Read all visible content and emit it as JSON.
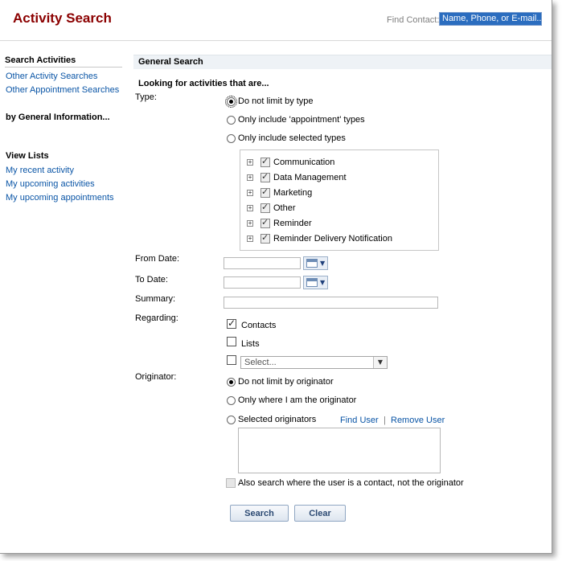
{
  "header": {
    "title": "Activity Search",
    "find_contact_label": "Find Contact:",
    "find_contact_value": "Name, Phone, or E-mail..."
  },
  "sidebar": {
    "search_activities_heading": "Search Activities",
    "search_links": [
      "Other Activity Searches",
      "Other Appointment Searches"
    ],
    "general_info_heading": "by General Information...",
    "view_lists_heading": "View Lists",
    "view_links": [
      "My recent activity",
      "My upcoming activities",
      "My upcoming appointments"
    ]
  },
  "main": {
    "section_title": "General Search",
    "looking_for": "Looking for activities that are...",
    "type_label": "Type:",
    "type_options": [
      {
        "label": "Do not limit by type",
        "selected": true
      },
      {
        "label": "Only include 'appointment' types",
        "selected": false
      },
      {
        "label": "Only include selected types",
        "selected": false
      }
    ],
    "type_tree": [
      {
        "label": "Communication",
        "checked": true
      },
      {
        "label": "Data Management",
        "checked": true
      },
      {
        "label": "Marketing",
        "checked": true
      },
      {
        "label": "Other",
        "checked": true
      },
      {
        "label": "Reminder",
        "checked": true
      },
      {
        "label": "Reminder Delivery Notification",
        "checked": true
      }
    ],
    "from_date_label": "From Date:",
    "to_date_label": "To Date:",
    "summary_label": "Summary:",
    "regarding_label": "Regarding:",
    "regarding_contacts": "Contacts",
    "regarding_lists": "Lists",
    "regarding_select_placeholder": "Select...",
    "originator_label": "Originator:",
    "originator_options": [
      {
        "label": "Do not limit by originator",
        "selected": true
      },
      {
        "label": "Only where I am the originator",
        "selected": false
      },
      {
        "label": "Selected originators",
        "selected": false
      }
    ],
    "find_user": "Find User",
    "separator": "|",
    "remove_user": "Remove User",
    "also_search": "Also search where the user is a contact, not the originator",
    "search_button": "Search",
    "clear_button": "Clear"
  }
}
